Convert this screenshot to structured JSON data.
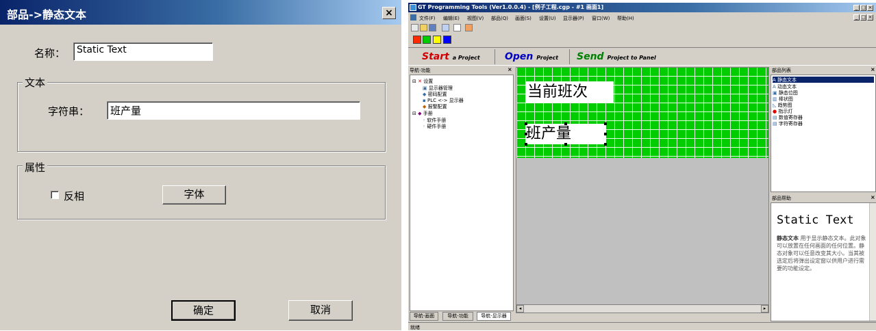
{
  "dialog": {
    "title": "部品->静态文本",
    "close_label": "×",
    "name_label": "名称：",
    "name_value": "Static Text",
    "text_group_label": "文本",
    "string_label": "字符串：",
    "string_value": "班产量",
    "attr_group_label": "属性",
    "invert_label": "反相",
    "invert_checked": false,
    "font_button": "字体",
    "ok_button": "确定",
    "cancel_button": "取消"
  },
  "app": {
    "title": "GT Programming Tools (Ver1.0.0.4) - [例子工程.cgp - #1 画面1]",
    "menu": [
      "文件(F)",
      "编辑(E)",
      "视图(V)",
      "部品(Q)",
      "画面(S)",
      "设置(U)",
      "显示器(P)",
      "窗口(W)",
      "帮助(H)"
    ],
    "palette_colors": [
      "#ff2a00",
      "#00cc00",
      "#ffff00",
      "#0000ff"
    ],
    "launch": {
      "start": "Start",
      "start_sub": "a Project",
      "open": "Open",
      "open_sub": "Project",
      "send": "Send",
      "send_sub": "Project to Panel"
    },
    "nav_panel_title": "导航-功能",
    "tree": {
      "settings": "设置",
      "display_mgmt": "显示器管理",
      "password": "密码配置",
      "plc_display": "PLC <-> 显示器",
      "alarm": "报警配置",
      "manual": "手册",
      "software_manual": "软件手册",
      "hardware_manual": "硬件手册"
    },
    "nav_tabs": [
      "导航-画面",
      "导航-功能",
      "导航-显示器"
    ],
    "canvas": {
      "text1": "当前班次",
      "text2": "班产量"
    },
    "parts_panel_title": "部品列表",
    "parts": [
      "静态文本",
      "动态文本",
      "静态位图",
      "棒状图",
      "趋势图",
      "指示灯",
      "数值寄存器",
      "字符寄存器"
    ],
    "help_panel_title": "部品帮助",
    "help_heading": "Static Text",
    "help_bold": "静态文本",
    "help_text": "用于显示静态文本。此对象可以放置在任何画面的任何位置。静态对象可以任意改变其大小。当其被选定后将弹出设定窗以供用户进行需要的功能设定。",
    "status": "就绪"
  }
}
